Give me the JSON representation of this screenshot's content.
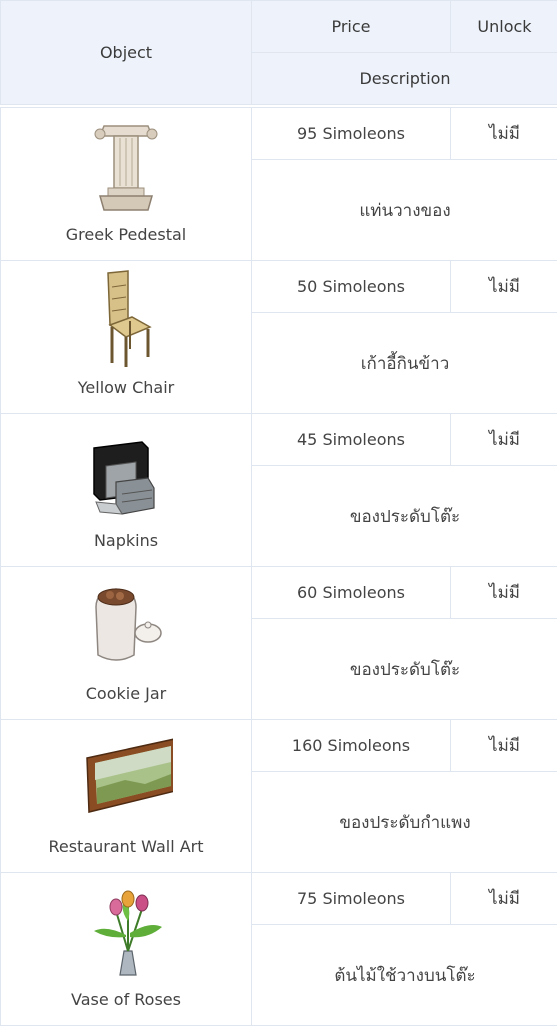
{
  "header": {
    "object": "Object",
    "price": "Price",
    "unlock": "Unlock",
    "description": "Description"
  },
  "items": [
    {
      "name": "Greek Pedestal",
      "price": "95 Simoleons",
      "unlock": "ไม่มี",
      "description": "แท่นวางของ",
      "icon": "pedestal-icon"
    },
    {
      "name": "Yellow Chair",
      "price": "50 Simoleons",
      "unlock": "ไม่มี",
      "description": "เก้าอี้กินข้าว",
      "icon": "chair-icon"
    },
    {
      "name": "Napkins",
      "price": "45 Simoleons",
      "unlock": "ไม่มี",
      "description": "ของประดับโต๊ะ",
      "icon": "napkins-icon"
    },
    {
      "name": "Cookie Jar",
      "price": "60 Simoleons",
      "unlock": "ไม่มี",
      "description": "ของประดับโต๊ะ",
      "icon": "cookie-jar-icon"
    },
    {
      "name": "Restaurant Wall Art",
      "price": "160 Simoleons",
      "unlock": "ไม่มี",
      "description": "ของประดับกำแพง",
      "icon": "wall-art-icon"
    },
    {
      "name": "Vase of Roses",
      "price": "75 Simoleons",
      "unlock": "ไม่มี",
      "description": "ต้นไม้ใช้วางบนโต๊ะ",
      "icon": "vase-icon"
    }
  ]
}
